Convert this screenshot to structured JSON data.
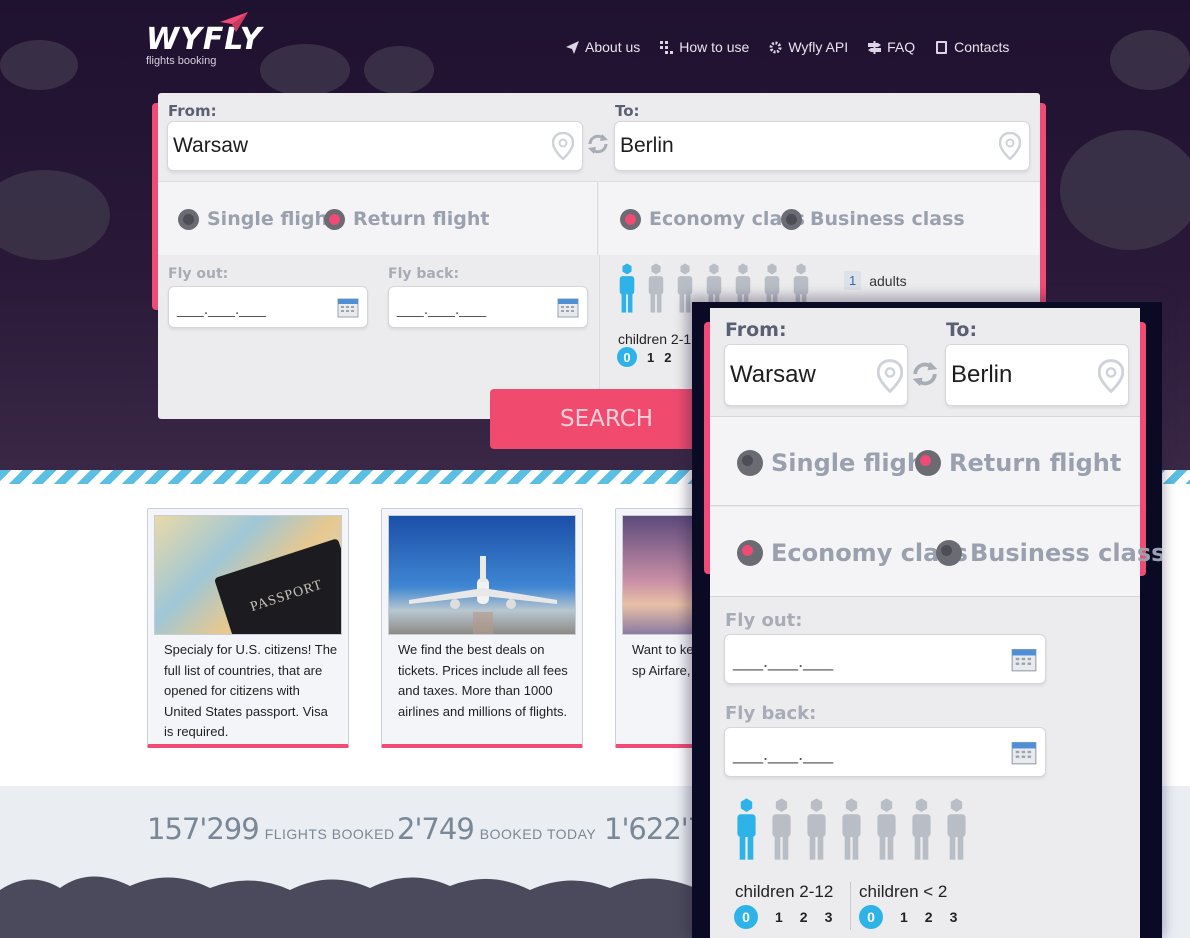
{
  "header": {
    "logo_text": "WYFLY",
    "logo_sub": "flights booking",
    "nav": [
      {
        "label": "About us",
        "icon": "paper-plane-icon"
      },
      {
        "label": "How to use",
        "icon": "grid-icon"
      },
      {
        "label": "Wyfly API",
        "icon": "gear-icon"
      },
      {
        "label": "FAQ",
        "icon": "signpost-icon"
      },
      {
        "label": "Contacts",
        "icon": "book-icon"
      }
    ]
  },
  "form": {
    "from_label": "From:",
    "from_value": "Warsaw",
    "to_label": "To:",
    "to_value": "Berlin",
    "trip": {
      "single": "Single flight",
      "return": "Return flight",
      "selected": "return"
    },
    "class": {
      "economy": "Economy class",
      "business": "Business class",
      "selected": "economy"
    },
    "fly_out_label": "Fly out:",
    "fly_back_label": "Fly back:",
    "date_placeholder": "___.___.___",
    "adults_count": "1",
    "adults_label": "adults",
    "children_label": "children 2-1",
    "children_nums": [
      "0",
      "1",
      "2"
    ],
    "search_label": "SEARCH"
  },
  "cards": [
    {
      "text": "Specialy for U.S. citizens! The full list of countries, that are opened for citizens with United States passport. Visa is required.",
      "image": "passport-map-image",
      "img_label": "PASSPORT"
    },
    {
      "text": "We find the best deals on tickets. Prices include all fees and taxes. More than 1000 airlines and millions of flights.",
      "image": "airplane-front-image"
    },
    {
      "text": "Want to ke latest new tourism, sp Airfare, ou and raffles",
      "image": "sunset-airplane-image"
    }
  ],
  "stats": [
    {
      "number": "157'299",
      "label": "FLIGHTS BOOKED"
    },
    {
      "number": "2'749",
      "label": "BOOKED TODAY"
    },
    {
      "number": "1'622'7",
      "label": ""
    }
  ],
  "mobile": {
    "from_label": "From:",
    "from_value": "Warsaw",
    "to_label": "To:",
    "to_value": "Berlin",
    "single": "Single flight",
    "return": "Return flight",
    "economy": "Economy class",
    "business": "Business class",
    "fly_out_label": "Fly out:",
    "fly_back_label": "Fly back:",
    "date_placeholder": "___.___.___",
    "children_a_label": "children 2-12",
    "children_b_label": "children < 2",
    "children_a_nums": [
      "0",
      "1",
      "2",
      "3"
    ],
    "children_b_nums": [
      "0",
      "1",
      "2",
      "3"
    ]
  },
  "colors": {
    "accent": "#f04b75",
    "blue": "#2db3e8",
    "hero": "#241433",
    "panel": "#ececee"
  }
}
